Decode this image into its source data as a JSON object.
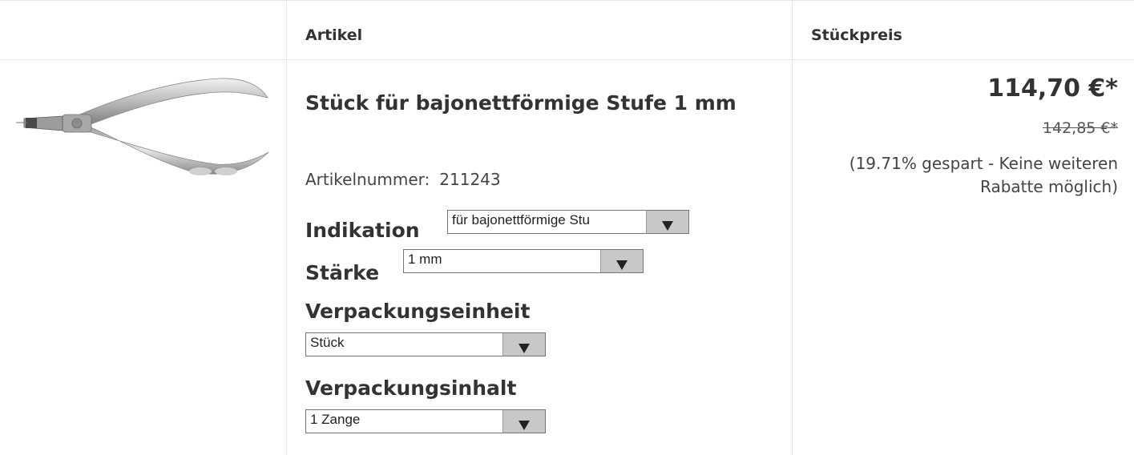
{
  "header": {
    "col_article": "Artikel",
    "col_price": "Stückpreis"
  },
  "product": {
    "title": "Stück für bajonettförmige Stufe 1 mm",
    "article_number_label": "Artikelnummer:",
    "article_number": "211243",
    "image_icon": "pliers-image",
    "options": {
      "indication": {
        "label": "Indikation",
        "value": "für bajonettförmige Stu"
      },
      "thickness": {
        "label": "Stärke",
        "value": "1 mm"
      },
      "packaging_unit": {
        "label": "Verpackungseinheit",
        "value": "Stück"
      },
      "packaging_content": {
        "label": "Verpackungsinhalt",
        "value": "1 Zange"
      }
    }
  },
  "pricing": {
    "price": "114,70 €*",
    "old_price": "142,85 €*",
    "saving_note": "(19.71% gespart - Keine weiteren Rabatte möglich)"
  }
}
